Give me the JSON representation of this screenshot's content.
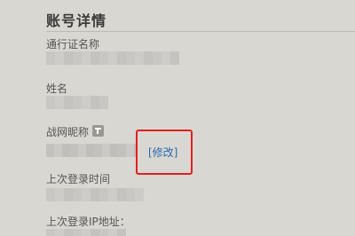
{
  "header": {
    "title": "账号详情"
  },
  "fields": {
    "account_label": "通行证名称",
    "name_label": "姓名",
    "nickname_label": "战网昵称",
    "edit_label": "[修改]",
    "last_login_time_label": "上次登录时间",
    "last_login_ip_label": "上次登录IP地址："
  },
  "colors": {
    "background": "#d9d7d2",
    "link": "#2a6ab0",
    "highlight": "#e02020"
  },
  "icons": {
    "nickname_info": "pencil-icon"
  }
}
